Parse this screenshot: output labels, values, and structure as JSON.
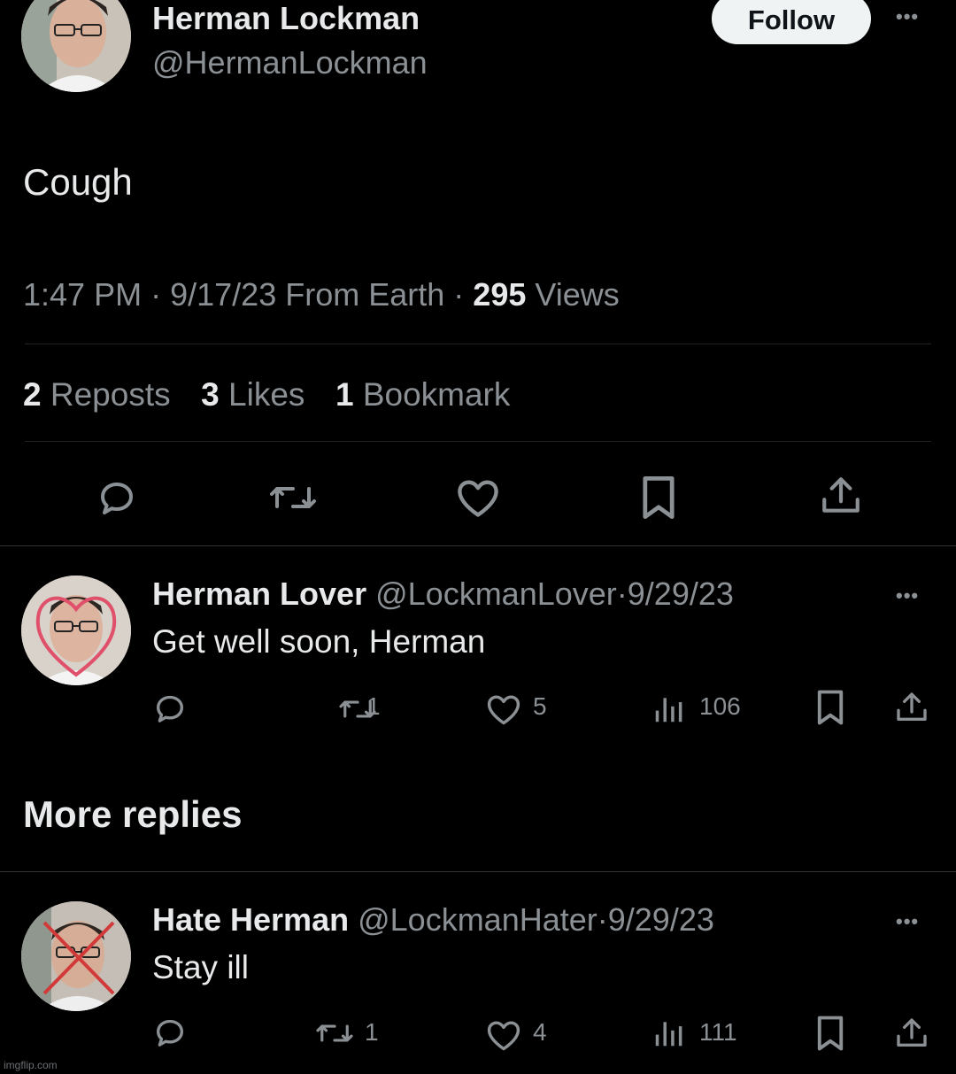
{
  "tweet": {
    "author_name": "Herman Lockman",
    "author_handle": "@HermanLockman",
    "follow_label": "Follow",
    "text": "Cough",
    "time": "1:47 PM",
    "date_source": "9/17/23 From Earth",
    "separator": "·",
    "views_count": "295",
    "views_label": "Views",
    "reposts_count": "2",
    "reposts_label": "Reposts",
    "likes_count": "3",
    "likes_label": "Likes",
    "bookmarks_count": "1",
    "bookmarks_label": "Bookmark",
    "action_icons": [
      "reply-icon",
      "repost-icon",
      "like-icon",
      "bookmark-icon",
      "share-icon"
    ]
  },
  "replies": [
    {
      "name": "Herman Lover",
      "handle": "@LockmanLover",
      "date": "9/29/23",
      "text": "Get well soon, Herman",
      "reposts": "1",
      "likes": "5",
      "views": "106"
    },
    {
      "name": "Hate Herman",
      "handle": "@LockmanHater",
      "date": "9/29/23",
      "text": "Stay ill",
      "reposts": "1",
      "likes": "4",
      "views": "111"
    }
  ],
  "more_replies_label": "More replies",
  "watermark": "imgflip.com",
  "colors": {
    "background": "#000000",
    "text": "#e7e9ea",
    "muted": "#8b9095",
    "heart_overlay": "#e0506a",
    "cross_overlay": "#d23a3a"
  }
}
